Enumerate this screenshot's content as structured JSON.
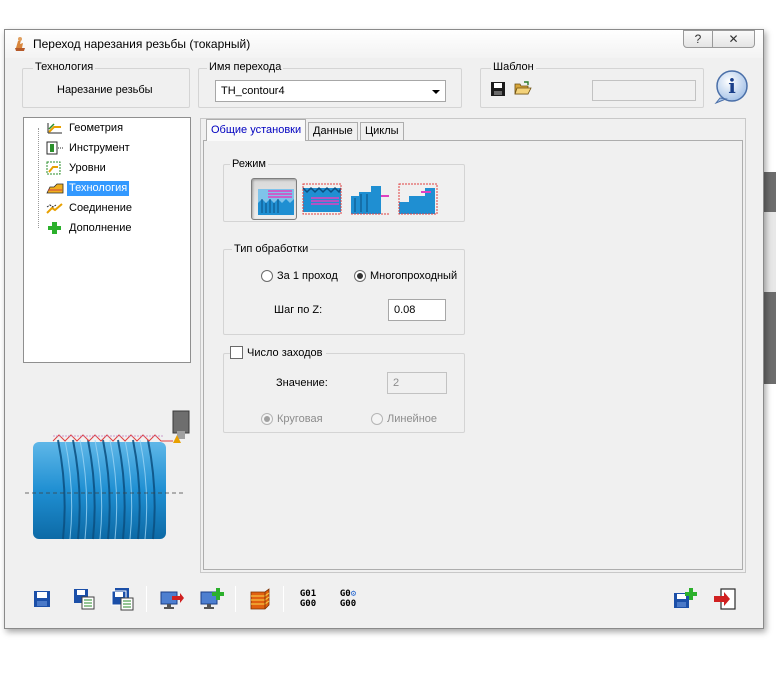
{
  "window": {
    "title": "Переход нарезания резьбы (токарный)",
    "help_label": "?",
    "close_label": "✕"
  },
  "technology_group": {
    "label": "Технология",
    "value": "Нарезание резьбы"
  },
  "transition_name_group": {
    "label": "Имя перехода",
    "value": "TH_contour4"
  },
  "template_group": {
    "label": "Шаблон",
    "value": ""
  },
  "info_icon": "i",
  "tree": {
    "items": [
      {
        "label": "Геометрия",
        "icon": "geometry-icon"
      },
      {
        "label": "Инструмент",
        "icon": "tool-icon"
      },
      {
        "label": "Уровни",
        "icon": "levels-icon"
      },
      {
        "label": "Технология",
        "icon": "technology-icon",
        "selected": true
      },
      {
        "label": "Соединение",
        "icon": "connection-icon"
      },
      {
        "label": "Дополнение",
        "icon": "addition-icon"
      }
    ]
  },
  "tabs": [
    {
      "label": "Общие установки",
      "active": true
    },
    {
      "label": "Данные"
    },
    {
      "label": "Циклы"
    }
  ],
  "mode_group": {
    "label": "Режим",
    "selected_index": 0
  },
  "processing_type": {
    "label": "Тип обработки",
    "options": [
      {
        "label": "За 1 проход",
        "checked": false
      },
      {
        "label": "Многопроходный",
        "checked": true
      }
    ],
    "step_label": "Шаг по Z:",
    "step_value": "0.08"
  },
  "starts_group": {
    "label": "Число заходов",
    "checked": false,
    "value_label": "Значение:",
    "value": "2",
    "options": [
      {
        "label": "Круговая",
        "checked": true
      },
      {
        "label": "Линейное",
        "checked": false
      }
    ]
  },
  "bottom_toolbar": {
    "gcode_left": [
      "G01",
      "G00"
    ],
    "gcode_right": [
      "G0",
      "G00"
    ]
  },
  "colors": {
    "accent": "#3399ff",
    "tab_active_text": "#0000c0",
    "part_blue": "#1f8fd2"
  }
}
